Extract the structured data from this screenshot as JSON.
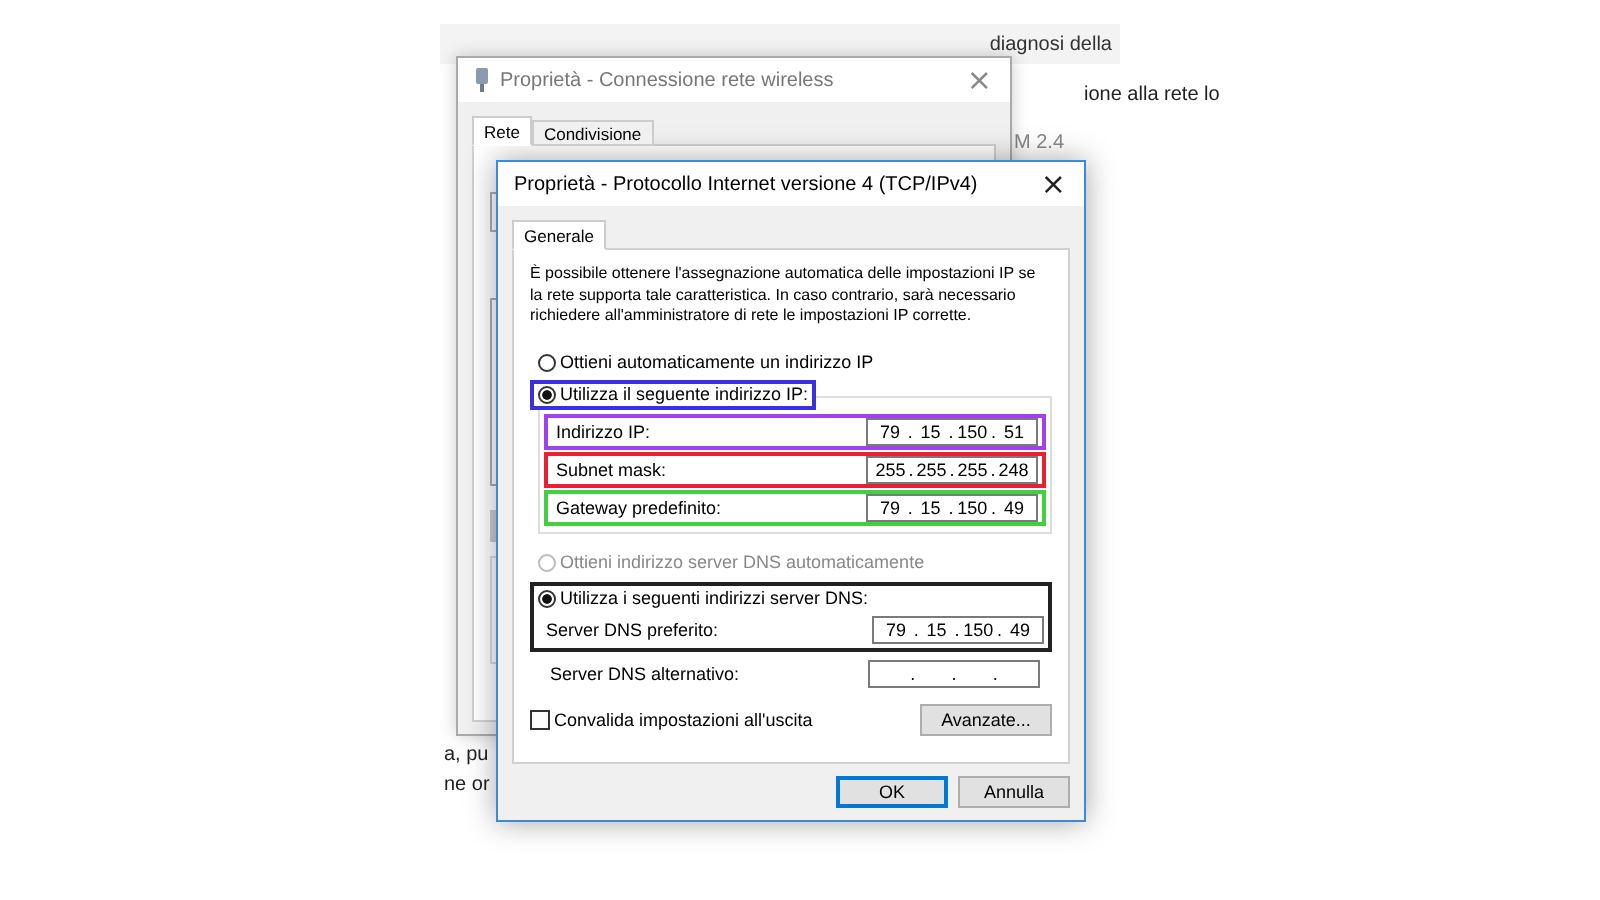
{
  "background_page": {
    "toolbar_fragment": "diagnosi della",
    "side_fragments": [
      "ione alla rete lo",
      "M 2.4"
    ],
    "bottom_fragments": [
      "a, pu",
      "ne or"
    ]
  },
  "back_window": {
    "title": "Proprietà - Connessione rete wireless",
    "close": "×",
    "tabs": [
      {
        "label": "Rete",
        "selected": true
      },
      {
        "label": "Condivisione",
        "selected": false
      }
    ]
  },
  "dialog": {
    "title": "Proprietà - Protocollo Internet versione 4 (TCP/IPv4)",
    "close": "×",
    "tabs": [
      {
        "label": "Generale",
        "selected": true
      }
    ],
    "description": "È possibile ottenere l'assegnazione automatica delle impostazioni IP se la rete supporta tale caratteristica. In caso contrario, sarà necessario richiedere all'amministratore di rete le impostazioni IP corrette.",
    "separator": ".",
    "ip_options": [
      {
        "label": "Ottieni automaticamente un indirizzo IP",
        "selected": false,
        "disabled": false
      },
      {
        "label": "Utilizza il seguente indirizzo IP:",
        "selected": true,
        "disabled": false,
        "color": "#3a30e0"
      }
    ],
    "ip_fields": [
      {
        "label": "Indirizzo IP:",
        "octets": [
          "79",
          "15",
          "150",
          "51"
        ],
        "color": "#a040f0"
      },
      {
        "label": "Subnet mask:",
        "octets": [
          "255",
          "255",
          "255",
          "248"
        ],
        "color": "#e82030"
      },
      {
        "label": "Gateway predefinito:",
        "octets": [
          "79",
          "15",
          "150",
          "49"
        ],
        "color": "#40d040"
      }
    ],
    "dns_options": [
      {
        "label": "Ottieni indirizzo server DNS automaticamente",
        "selected": false,
        "disabled": true
      },
      {
        "label": "Utilizza i seguenti indirizzi server DNS:",
        "selected": true,
        "disabled": false
      }
    ],
    "dns_frame": {
      "color": "#222222"
    },
    "dns_fields": [
      {
        "label": "Server DNS preferito:",
        "octets": [
          "79",
          "15",
          "150",
          "49"
        ]
      },
      {
        "label": "Server DNS alternativo:"
      }
    ],
    "validate": {
      "label": "Convalida impostazioni all'uscita",
      "checked": false
    },
    "advanced_button": "Avanzate...",
    "buttons": [
      {
        "label": "OK",
        "default": true
      },
      {
        "label": "Annulla",
        "default": false
      }
    ]
  }
}
